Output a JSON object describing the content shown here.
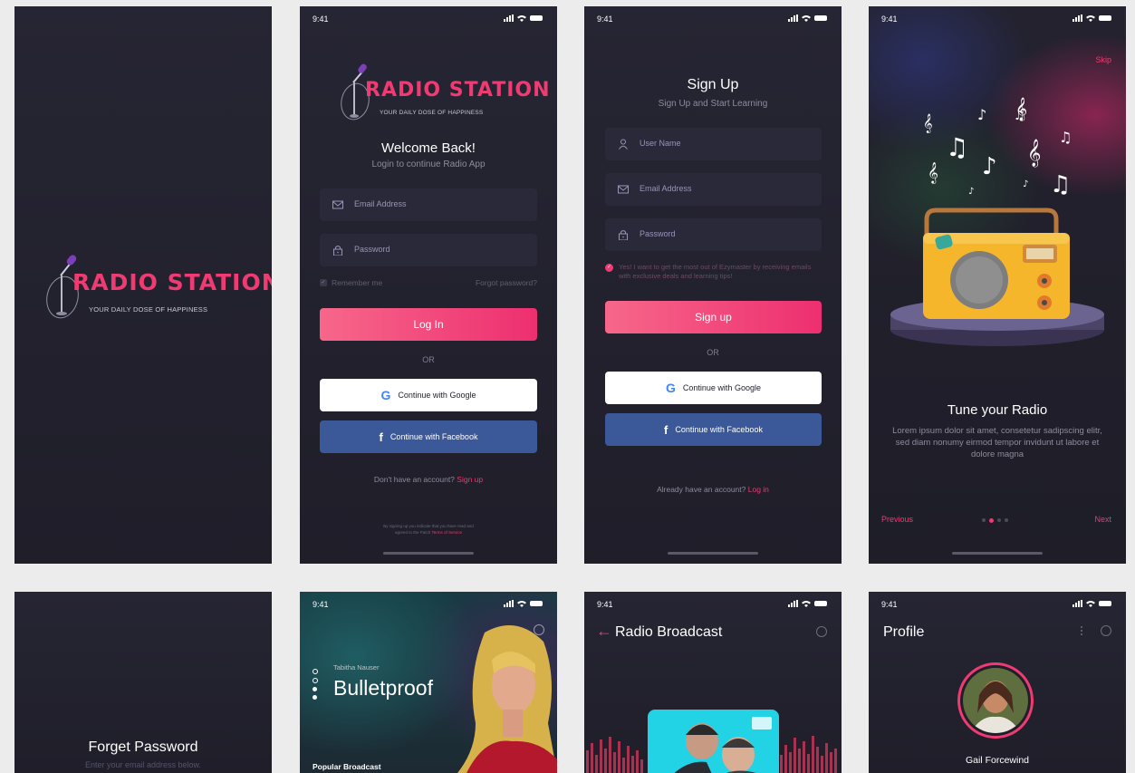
{
  "status": {
    "time": "9:41"
  },
  "brand": {
    "name": "RADIO STATION",
    "tagline": "YOUR DAILY DOSE OF HAPPINESS",
    "accent": "#ef3b72"
  },
  "login": {
    "title": "Welcome Back!",
    "subtitle": "Login to continue Radio App",
    "email_placeholder": "Email Address",
    "password_placeholder": "Password",
    "remember": "Remember me",
    "forgot": "Forgot password?",
    "login_button": "Log In",
    "or": "OR",
    "google": "Continue with Google",
    "facebook": "Continue with Facebook",
    "no_account": "Don't have an account?",
    "signup_link": "Sign up",
    "terms_prefix": "By signing up you indicate that you have read and",
    "terms_mid": "agreed to the Patch",
    "terms_link": "Terms of Service"
  },
  "signup": {
    "title": "Sign Up",
    "subtitle": "Sign Up and Start Learning",
    "username_placeholder": "User Name",
    "email_placeholder": "Email Address",
    "password_placeholder": "Password",
    "consent": "Yes! I want to get the most out of Ezymaster by receiving emails with exclusive deals and learning tips!",
    "signup_button": "Sign up",
    "or": "OR",
    "google": "Continue with Google",
    "facebook": "Continue with Facebook",
    "have_account": "Already have an account?",
    "login_link": "Log in"
  },
  "onboarding": {
    "skip": "Skip",
    "title": "Tune your Radio",
    "body": "Lorem ipsum dolor sit amet, consetetur sadipscing elitr, sed diam nonumy eirmod tempor invidunt ut labore et dolore magna",
    "previous": "Previous",
    "next": "Next",
    "page_count": 4,
    "active_page": 2
  },
  "forgot": {
    "title": "Forget Password",
    "subtitle": "Enter your email address below."
  },
  "player": {
    "artist": "Tabitha Nauser",
    "song": "Bulletproof",
    "section": "Popular Broadcast"
  },
  "broadcast": {
    "title": "Radio Broadcast"
  },
  "profile": {
    "title": "Profile",
    "name": "Gail Forcewind"
  }
}
